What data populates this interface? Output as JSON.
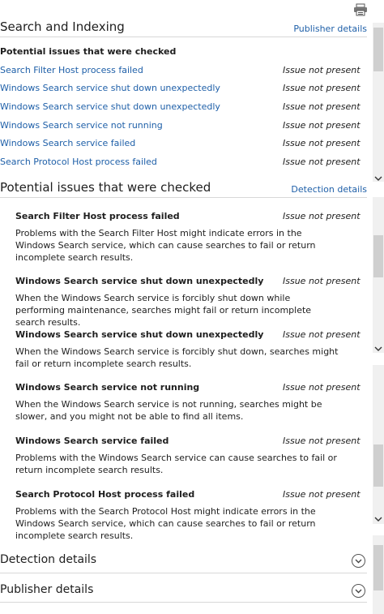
{
  "top_section": {
    "title": "Search and Indexing",
    "link": "Publisher details",
    "subheading": "Potential issues that were checked",
    "issues": [
      {
        "label": "Search Filter Host process failed",
        "status": "Issue not present"
      },
      {
        "label": "Windows Search service shut down unexpectedly",
        "status": "Issue not present"
      },
      {
        "label": "Windows Search service shut down unexpectedly",
        "status": "Issue not present"
      },
      {
        "label": "Windows Search service not running",
        "status": "Issue not present"
      },
      {
        "label": "Windows Search service failed",
        "status": "Issue not present"
      },
      {
        "label": "Search Protocol Host process failed",
        "status": "Issue not present"
      }
    ]
  },
  "detail_section": {
    "title": "Potential issues that were checked",
    "link": "Detection details",
    "items": [
      {
        "title": "Search Filter Host process failed",
        "status": "Issue not present",
        "desc": "Problems with the Search Filter Host might indicate errors in the Windows Search service, which can cause searches to fail or return incomplete search results."
      },
      {
        "title": "Windows Search service shut down unexpectedly",
        "status": "Issue not present",
        "desc": "When the Windows Search service is forcibly shut down while performing maintenance, searches might fail or return incomplete search results."
      },
      {
        "title": "Windows Search service shut down unexpectedly",
        "status": "Issue not present",
        "desc": "When the Windows Search service is forcibly shut down, searches might fail or return incomplete search results."
      },
      {
        "title": "Windows Search service not running",
        "status": "Issue not present",
        "desc": "When the Windows Search service is not running, searches might be slower, and you might not be able to find all items."
      },
      {
        "title": "Windows Search service failed",
        "status": "Issue not present",
        "desc": "Problems with the Windows Search service can cause searches to fail or return incomplete search results."
      },
      {
        "title": "Search Protocol Host process failed",
        "status": "Issue not present",
        "desc": "Problems with the Search Protocol Host might indicate errors in the Windows Search service, which can cause searches to fail or return incomplete search results."
      }
    ]
  },
  "expanders": [
    {
      "title": "Detection details",
      "icon": "chevron-down-icon"
    },
    {
      "title": "Publisher details",
      "icon": "chevron-down-icon"
    }
  ],
  "colors": {
    "link": "#1e5fa8",
    "text": "#1e1e1e",
    "rule": "#d8d8d8"
  }
}
